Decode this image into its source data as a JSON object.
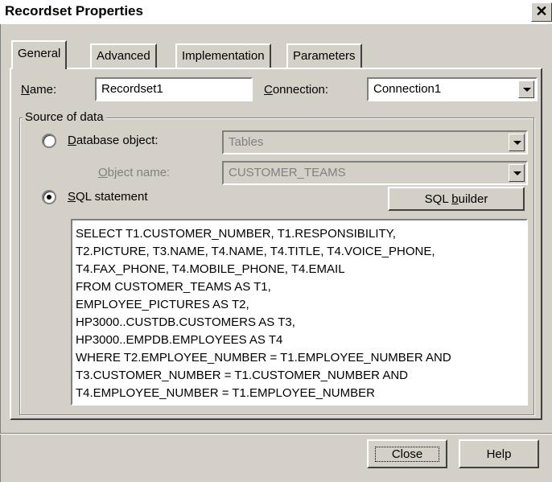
{
  "window": {
    "title": "Recordset Properties",
    "close_label": "✕"
  },
  "tabs": [
    {
      "label": "General",
      "active": true
    },
    {
      "label": "Advanced",
      "active": false
    },
    {
      "label": "Implementation",
      "active": false
    },
    {
      "label": "Parameters",
      "active": false
    }
  ],
  "general": {
    "name_label": "Name:",
    "name_value": "Recordset1",
    "connection_label": "Connection:",
    "connection_value": "Connection1",
    "source_group_label": "Source of data",
    "db_object_label": "Database object:",
    "db_object_value": "Tables",
    "db_object_selected": false,
    "object_name_label": "Object name:",
    "object_name_value": "CUSTOMER_TEAMS",
    "sql_label": "SQL statement",
    "sql_selected": true,
    "sql_builder_label": "SQL builder",
    "sql_text": "SELECT T1.CUSTOMER_NUMBER, T1.RESPONSIBILITY,\nT2.PICTURE, T3.NAME, T4.NAME, T4.TITLE, T4.VOICE_PHONE,\nT4.FAX_PHONE, T4.MOBILE_PHONE, T4.EMAIL\nFROM CUSTOMER_TEAMS AS T1,\nEMPLOYEE_PICTURES AS T2,\nHP3000..CUSTDB.CUSTOMERS AS T3,\nHP3000..EMPDB.EMPLOYEES AS T4\nWHERE T2.EMPLOYEE_NUMBER = T1.EMPLOYEE_NUMBER AND\nT3.CUSTOMER_NUMBER = T1.CUSTOMER_NUMBER AND\nT4.EMPLOYEE_NUMBER = T1.EMPLOYEE_NUMBER"
  },
  "footer": {
    "close_label": "Close",
    "help_label": "Help"
  }
}
